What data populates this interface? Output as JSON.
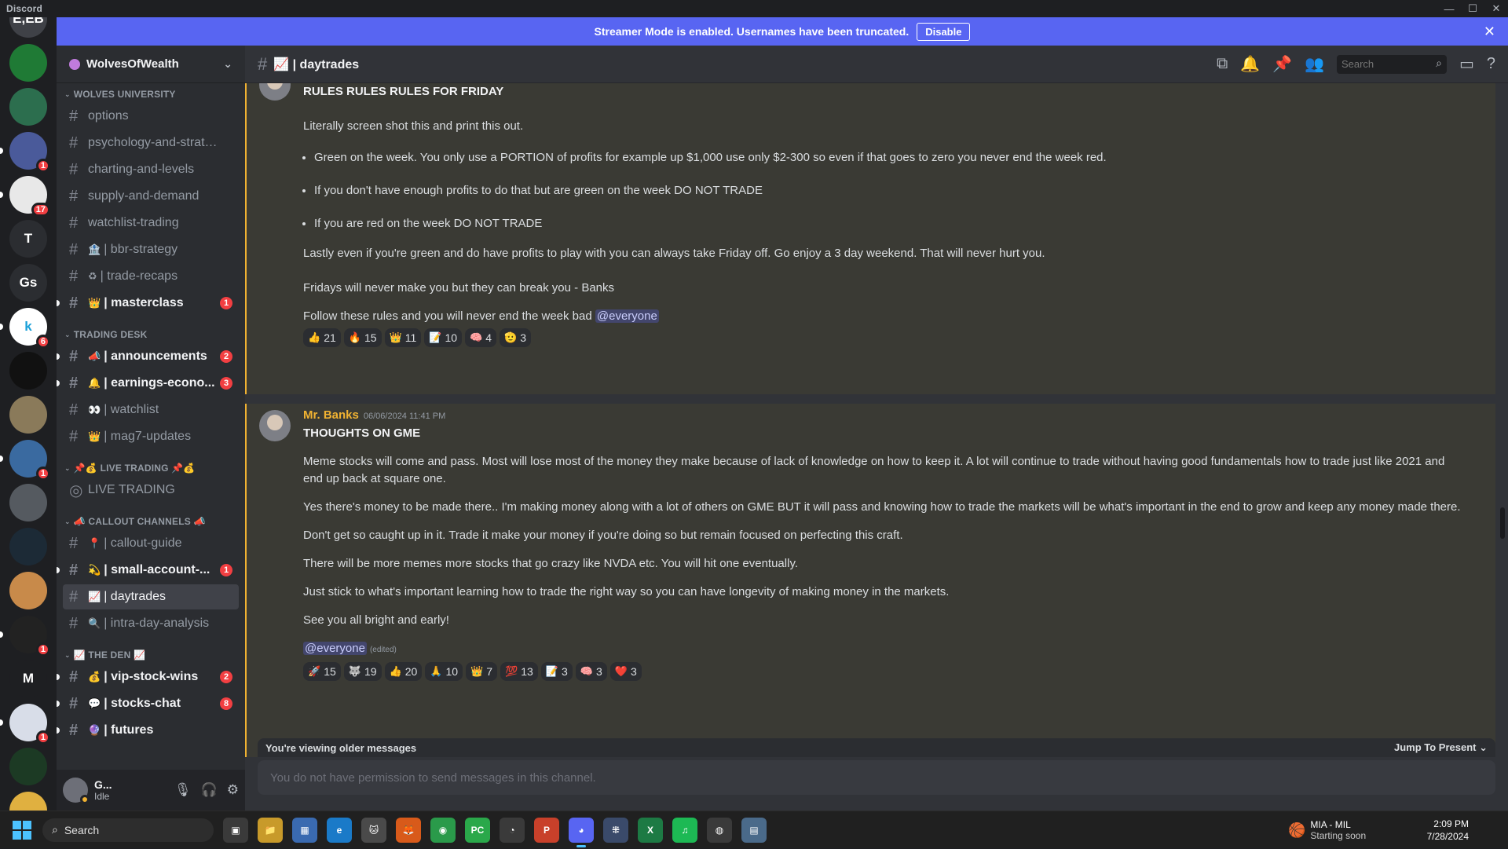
{
  "app": {
    "wordmark": "Discord"
  },
  "window_controls": {
    "minimize": "—",
    "maximize": "☐",
    "close": "✕"
  },
  "banner": {
    "text": "Streamer Mode is enabled. Usernames have been truncated.",
    "button": "Disable",
    "close": "✕"
  },
  "servers": [
    {
      "label": "E,EB",
      "color": "#3f4147",
      "badge": ""
    },
    {
      "label": "",
      "color": "#1f7a35",
      "badge": ""
    },
    {
      "label": "",
      "color": "#2c6e4e",
      "badge": ""
    },
    {
      "label": "",
      "color": "#4a5a9a",
      "badge": "1"
    },
    {
      "label": "",
      "color": "#e8e8e8",
      "badge": "17"
    },
    {
      "label": "T",
      "color": "#2b2d31",
      "badge": ""
    },
    {
      "label": "Gs",
      "color": "#2b2d31",
      "badge": ""
    },
    {
      "label": "k",
      "color": "#ffffff",
      "badge": "6"
    },
    {
      "label": "",
      "color": "#111111",
      "badge": ""
    },
    {
      "label": "",
      "color": "#8a7a5a",
      "badge": ""
    },
    {
      "label": "",
      "color": "#3a6aa0",
      "badge": "1"
    },
    {
      "label": "",
      "color": "#555a60",
      "badge": ""
    },
    {
      "label": "",
      "color": "#1c2a36",
      "badge": ""
    },
    {
      "label": "",
      "color": "#c88a4a",
      "badge": ""
    },
    {
      "label": "",
      "color": "#222222",
      "badge": "1"
    },
    {
      "label": "M",
      "color": "#1e1f22",
      "badge": ""
    },
    {
      "label": "",
      "color": "#d8dde8",
      "badge": "1"
    },
    {
      "label": "",
      "color": "#1c3a24",
      "badge": ""
    },
    {
      "label": "",
      "color": "#e0b040",
      "badge": ""
    }
  ],
  "guild": {
    "name": "WolvesOfWealth"
  },
  "categories": [
    {
      "name": "WOLVES UNIVERSITY",
      "channels": [
        {
          "emoji": "",
          "name": "options",
          "unread": false,
          "badge": ""
        },
        {
          "emoji": "",
          "name": "psychology-and-strategi...",
          "unread": false,
          "badge": ""
        },
        {
          "emoji": "",
          "name": "charting-and-levels",
          "unread": false,
          "badge": ""
        },
        {
          "emoji": "",
          "name": "supply-and-demand",
          "unread": false,
          "badge": ""
        },
        {
          "emoji": "",
          "name": "watchlist-trading",
          "unread": false,
          "badge": ""
        },
        {
          "emoji": "🏦",
          "name": "| bbr-strategy",
          "unread": false,
          "badge": ""
        },
        {
          "emoji": "♻",
          "name": "| trade-recaps",
          "unread": false,
          "badge": ""
        },
        {
          "emoji": "👑",
          "name": "| masterclass",
          "unread": true,
          "badge": "1"
        }
      ]
    },
    {
      "name": "TRADING DESK",
      "channels": [
        {
          "emoji": "📣",
          "name": "| announcements",
          "unread": true,
          "badge": "2"
        },
        {
          "emoji": "🔔",
          "name": "| earnings-econo...",
          "unread": true,
          "badge": "3"
        },
        {
          "emoji": "👀",
          "name": "| watchlist",
          "unread": false,
          "badge": ""
        },
        {
          "emoji": "👑",
          "name": "| mag7-updates",
          "unread": false,
          "badge": ""
        }
      ]
    },
    {
      "name": "📌💰 LIVE TRADING 📌💰",
      "channels": [
        {
          "emoji": "",
          "name": "LIVE TRADING",
          "unread": false,
          "badge": "",
          "stage": true
        }
      ]
    },
    {
      "name": "📣 CALLOUT CHANNELS 📣",
      "channels": [
        {
          "emoji": "📍",
          "name": "| callout-guide",
          "unread": false,
          "badge": ""
        },
        {
          "emoji": "💫",
          "name": "| small-account-...",
          "unread": true,
          "badge": "1"
        },
        {
          "emoji": "📈",
          "name": "| daytrades",
          "unread": false,
          "badge": "",
          "active": true
        },
        {
          "emoji": "🔍",
          "name": "| intra-day-analysis",
          "unread": false,
          "badge": ""
        }
      ]
    },
    {
      "name": "📈 THE DEN 📈",
      "channels": [
        {
          "emoji": "💰",
          "name": "| vip-stock-wins",
          "unread": true,
          "badge": "2"
        },
        {
          "emoji": "💬",
          "name": "| stocks-chat",
          "unread": true,
          "badge": "8"
        },
        {
          "emoji": "🔮",
          "name": "| futures",
          "unread": true,
          "badge": ""
        }
      ]
    }
  ],
  "user": {
    "name": "G...",
    "status": "Idle"
  },
  "channel_header": {
    "name": "📈 | daytrades",
    "search_placeholder": "Search"
  },
  "messages": [
    {
      "heading": "RULES RULES RULES FOR FRIDAY",
      "intro": "Literally screen shot this and print this out.",
      "bullets": [
        "Green on the week. You only use a PORTION of profits for example up $1,000 use only $2-300 so even if that goes to zero you never end the week red.",
        "If you don't have enough profits to do that but are green on the week DO NOT TRADE",
        "If you are red on the week DO NOT TRADE"
      ],
      "paras": [
        "Lastly even if you're green and do have profits to play with you can always take Friday off. Go enjoy a 3 day weekend. That will never hurt you.",
        "Fridays will never make you but they can break you - Banks"
      ],
      "closing": "Follow these rules and you will never end the week bad",
      "mention": "@everyone",
      "reactions": [
        {
          "emoji": "👍",
          "count": "21"
        },
        {
          "emoji": "🔥",
          "count": "15"
        },
        {
          "emoji": "👑",
          "count": "11"
        },
        {
          "emoji": "📝",
          "count": "10"
        },
        {
          "emoji": "🧠",
          "count": "4"
        },
        {
          "emoji": "🫡",
          "count": "3"
        }
      ]
    },
    {
      "author": "Mr. Banks",
      "timestamp": "06/06/2024 11:41 PM",
      "heading": "THOUGHTS ON GME",
      "paras": [
        "Meme stocks will come and pass. Most will lose most of the money they make because of lack of knowledge on how to keep it. A lot will continue to trade without having good fundamentals how to trade just like 2021 and end up back at square one.",
        "Yes there's money to be made there.. I'm making money along with a lot of others on GME BUT it will pass and knowing how to trade the markets will be what's important in the end to grow and keep any money made there.",
        "Don't get so caught up in it. Trade it make your money if you're doing so but remain focused on perfecting this craft.",
        "There will be more memes more stocks that go crazy like NVDA etc. You will hit one eventually.",
        "Just stick to what's important learning how to trade the right way so you can have longevity of making money in the markets.",
        "See you all bright and early!"
      ],
      "mention": "@everyone",
      "edited": "(edited)",
      "reactions": [
        {
          "emoji": "🚀",
          "count": "15"
        },
        {
          "emoji": "🐺",
          "count": "19"
        },
        {
          "emoji": "👍",
          "count": "20"
        },
        {
          "emoji": "🙏",
          "count": "10"
        },
        {
          "emoji": "👑",
          "count": "7"
        },
        {
          "emoji": "💯",
          "count": "13"
        },
        {
          "emoji": "📝",
          "count": "3"
        },
        {
          "emoji": "🧠",
          "count": "3"
        },
        {
          "emoji": "❤️",
          "count": "3"
        }
      ]
    }
  ],
  "older_bar": {
    "text": "You're viewing older messages",
    "jump": "Jump To Present ⌄"
  },
  "composer": {
    "placeholder": "You do not have permission to send messages in this channel."
  },
  "taskbar": {
    "search": "Search",
    "apps": [
      {
        "glyph": "▣",
        "color": "#3a3a3a"
      },
      {
        "glyph": "📁",
        "color": "#c89a2a"
      },
      {
        "glyph": "▦",
        "color": "#3a6ab0"
      },
      {
        "glyph": "e",
        "color": "#1a7ac8"
      },
      {
        "glyph": "🐱",
        "color": "#4a4a4a"
      },
      {
        "glyph": "🦊",
        "color": "#d85a1a"
      },
      {
        "glyph": "◉",
        "color": "#2a9a4a"
      },
      {
        "glyph": "PC",
        "color": "#2aa84a"
      },
      {
        "glyph": "◔",
        "color": "#3a3a3a"
      },
      {
        "glyph": "P",
        "color": "#c8402a"
      },
      {
        "glyph": "◕",
        "color": "#5865f2",
        "active": true
      },
      {
        "glyph": "⁜",
        "color": "#3a4a6a"
      },
      {
        "glyph": "X",
        "color": "#1d7a44"
      },
      {
        "glyph": "♫",
        "color": "#1db954"
      },
      {
        "glyph": "◍",
        "color": "#3a3a3a"
      },
      {
        "glyph": "▤",
        "color": "#4a6a8a"
      }
    ],
    "weather_title": "MIA - MIL",
    "weather_sub": "Starting soon",
    "time": "2:09 PM",
    "date": "7/28/2024"
  }
}
